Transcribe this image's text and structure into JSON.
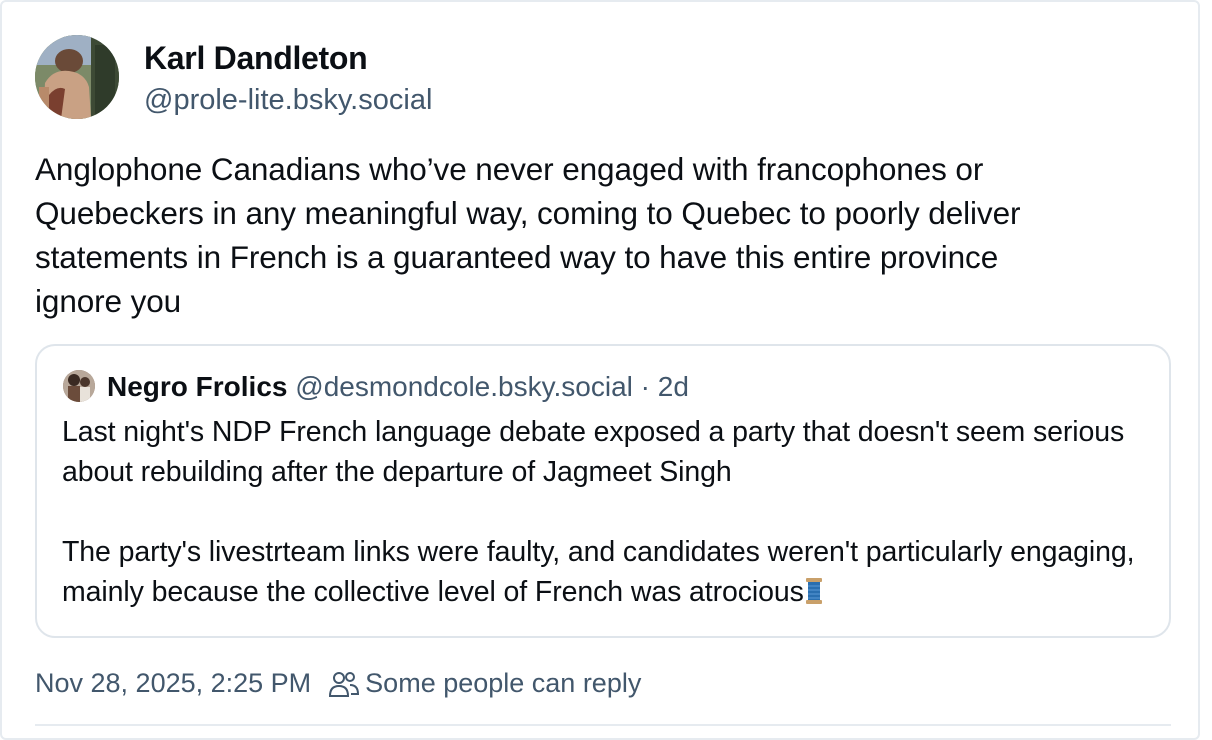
{
  "post": {
    "author": {
      "display_name": "Karl Dandleton",
      "handle": "@prole-lite.bsky.social",
      "avatar_icon": "profile-photo"
    },
    "text": "Anglophone Canadians who’ve never engaged with francophones or\nQuebeckers in any meaningful way, coming to Quebec to poorly deliver\nstatements in French is a guaranteed way to have this entire province\nignore you",
    "quote": {
      "author_name": "Negro Frolics",
      "author_handle": "@desmondcole.bsky.social",
      "time_ago": " · 2d",
      "paragraphs": [
        "Last night's NDP French language debate exposed a party that doesn't seem serious about rebuilding after the departure of Jagmeet Singh",
        "The party's livestrteam links were faulty, and candidates weren't particularly engaging, mainly because the collective level of French was atrocious"
      ],
      "trailing_emoji_icon": "spool-of-thread-icon"
    },
    "timestamp": "Nov 28, 2025, 2:25 PM",
    "reply_setting": "Some people can reply",
    "reply_icon": "people-icon"
  },
  "colors": {
    "text_primary": "#0b0f14",
    "text_secondary": "#42576c",
    "border": "#e6ebf0"
  }
}
